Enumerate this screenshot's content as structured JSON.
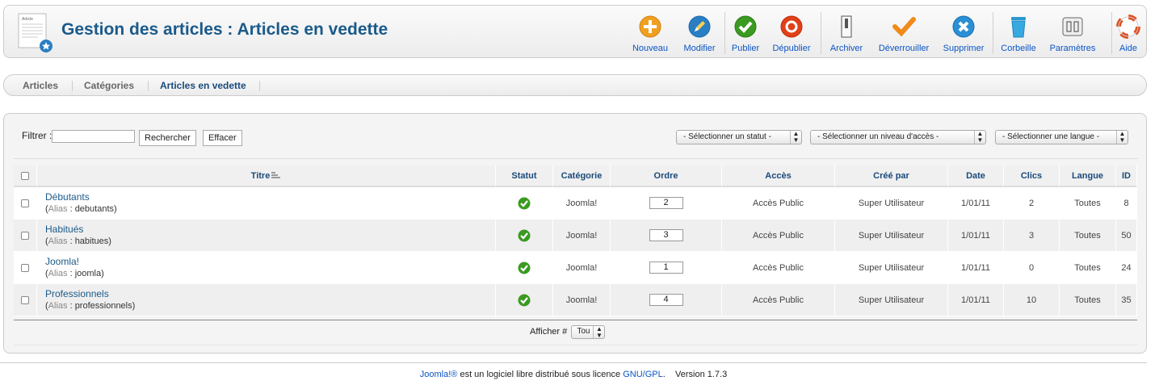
{
  "header": {
    "title": "Gestion des articles : Articles en vedette",
    "page_icon": "featured-articles-icon"
  },
  "toolbar": {
    "buttons": [
      {
        "label": "Nouveau",
        "icon": "plus-circle-icon",
        "color": "#f0a020"
      },
      {
        "label": "Modifier",
        "icon": "pencil-icon",
        "color": "#2a7fc4"
      },
      {
        "label": "Publier",
        "icon": "check-circle-icon",
        "color": "#3a9a22"
      },
      {
        "label": "Dépublier",
        "icon": "stop-circle-icon",
        "color": "#e04018"
      },
      {
        "label": "Archiver",
        "icon": "archive-icon",
        "color": "#666666"
      },
      {
        "label": "Déverrouiller",
        "icon": "checkmark-icon",
        "color": "#f08a18"
      },
      {
        "label": "Supprimer",
        "icon": "x-circle-icon",
        "color": "#2a8fd4"
      },
      {
        "label": "Corbeille",
        "icon": "trash-icon",
        "color": "#38a8e0"
      },
      {
        "label": "Paramètres",
        "icon": "settings-icon",
        "color": "#777777"
      },
      {
        "label": "Aide",
        "icon": "lifebuoy-icon",
        "color": "#e05020"
      }
    ]
  },
  "submenu": {
    "items": [
      {
        "label": "Articles",
        "active": false
      },
      {
        "label": "Catégories",
        "active": false
      },
      {
        "label": "Articles en vedette",
        "active": true
      }
    ]
  },
  "filter": {
    "label": "Filtrer :",
    "search_value": "",
    "search_button": "Rechercher",
    "clear_button": "Effacer",
    "status_select": "- Sélectionner un statut -",
    "access_select": "- Sélectionner un niveau d'accès -",
    "language_select": "- Sélectionner une langue -"
  },
  "table": {
    "columns": [
      "Titre",
      "Statut",
      "Catégorie",
      "Ordre",
      "Accès",
      "Créé par",
      "Date",
      "Clics",
      "Langue",
      "ID"
    ],
    "alias_label": "Alias",
    "rows": [
      {
        "title": "Débutants",
        "alias": "debutants",
        "category": "Joomla!",
        "order": "2",
        "access": "Accès Public",
        "created_by": "Super Utilisateur",
        "date": "1/01/11",
        "hits": "2",
        "language": "Toutes",
        "id": "8"
      },
      {
        "title": "Habitués",
        "alias": "habitues",
        "category": "Joomla!",
        "order": "3",
        "access": "Accès Public",
        "created_by": "Super Utilisateur",
        "date": "1/01/11",
        "hits": "3",
        "language": "Toutes",
        "id": "50"
      },
      {
        "title": "Joomla!",
        "alias": "joomla",
        "category": "Joomla!",
        "order": "1",
        "access": "Accès Public",
        "created_by": "Super Utilisateur",
        "date": "1/01/11",
        "hits": "0",
        "language": "Toutes",
        "id": "24"
      },
      {
        "title": "Professionnels",
        "alias": "professionnels",
        "category": "Joomla!",
        "order": "4",
        "access": "Accès Public",
        "created_by": "Super Utilisateur",
        "date": "1/01/11",
        "hits": "10",
        "language": "Toutes",
        "id": "35"
      }
    ]
  },
  "pager": {
    "label": "Afficher #",
    "value": "Tou"
  },
  "footer": {
    "joomla_link": "Joomla!®",
    "text": " est un logiciel libre distribué sous licence ",
    "license_link": "GNU/GPL",
    "version": ".    Version 1.7.3"
  }
}
